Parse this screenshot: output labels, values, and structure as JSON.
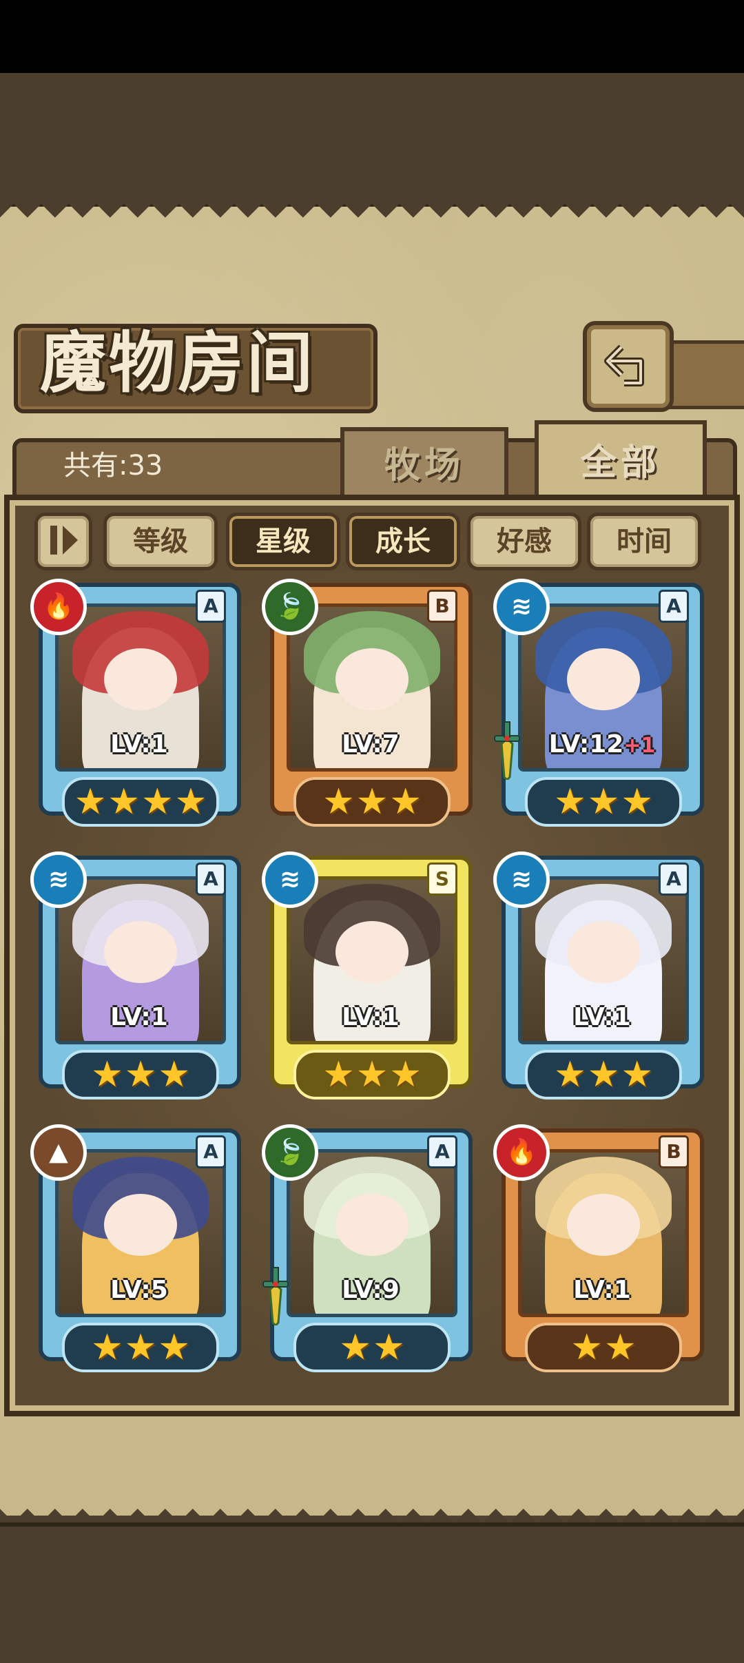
{
  "title": "魔物房间",
  "count_label": "共有:33",
  "tabs": [
    {
      "label": "牧场",
      "active": false
    },
    {
      "label": "全部",
      "active": true
    }
  ],
  "filters": [
    {
      "label": "等级",
      "active": false
    },
    {
      "label": "星级",
      "active": true
    },
    {
      "label": "成长",
      "active": true
    },
    {
      "label": "好感",
      "active": false
    },
    {
      "label": "时间",
      "active": false
    }
  ],
  "cards": [
    {
      "grade": "A",
      "element": "fire",
      "level": "LV:1",
      "bonus": "",
      "stars": 4,
      "frame": "blue",
      "weapon": false
    },
    {
      "grade": "B",
      "element": "leaf",
      "level": "LV:7",
      "bonus": "",
      "stars": 3,
      "frame": "orange",
      "weapon": false
    },
    {
      "grade": "A",
      "element": "water",
      "level": "LV:12",
      "bonus": "+1",
      "stars": 3,
      "frame": "blue",
      "weapon": true
    },
    {
      "grade": "A",
      "element": "water",
      "level": "LV:1",
      "bonus": "",
      "stars": 3,
      "frame": "blue",
      "weapon": false
    },
    {
      "grade": "S",
      "element": "water",
      "level": "LV:1",
      "bonus": "",
      "stars": 3,
      "frame": "yellow",
      "weapon": false
    },
    {
      "grade": "A",
      "element": "water",
      "level": "LV:1",
      "bonus": "",
      "stars": 3,
      "frame": "blue",
      "weapon": false
    },
    {
      "grade": "A",
      "element": "earth",
      "level": "LV:5",
      "bonus": "",
      "stars": 3,
      "frame": "blue",
      "weapon": false
    },
    {
      "grade": "A",
      "element": "leaf",
      "level": "LV:9",
      "bonus": "",
      "stars": 2,
      "frame": "blue",
      "weapon": true
    },
    {
      "grade": "B",
      "element": "fire",
      "level": "LV:1",
      "bonus": "",
      "stars": 2,
      "frame": "orange",
      "weapon": false
    }
  ],
  "icons": {
    "back": "back-arrow-icon",
    "toggle": "sort-toggle-icon"
  },
  "colors": {
    "frame_blue": "#7fc3e3",
    "frame_orange": "#e0924a",
    "frame_yellow": "#f2e460",
    "star": "#ffc62a"
  }
}
